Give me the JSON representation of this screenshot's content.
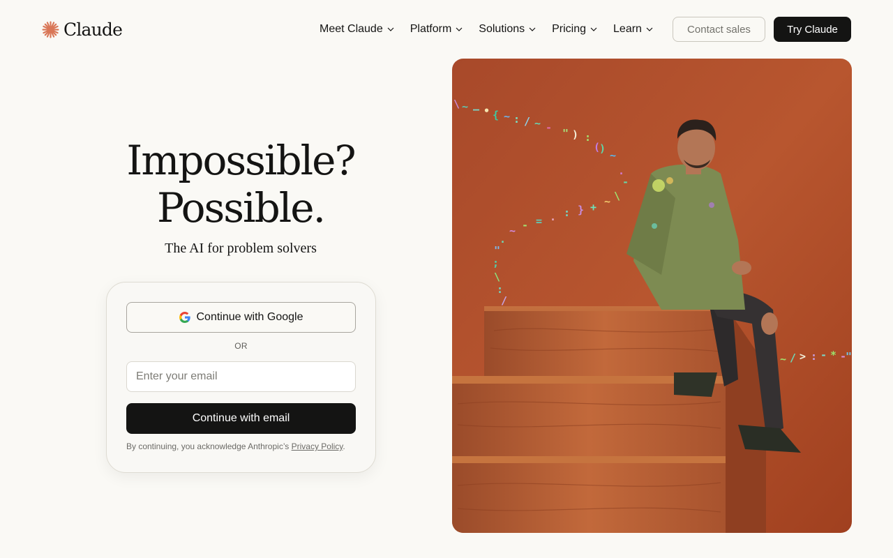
{
  "header": {
    "logo_text": "Claude",
    "logo_icon": "claude-starburst-icon",
    "nav": [
      {
        "label": "Meet Claude",
        "icon": "chevron-down-icon"
      },
      {
        "label": "Platform",
        "icon": "chevron-down-icon"
      },
      {
        "label": "Solutions",
        "icon": "chevron-down-icon"
      },
      {
        "label": "Pricing",
        "icon": "chevron-down-icon"
      },
      {
        "label": "Learn",
        "icon": "chevron-down-icon"
      }
    ],
    "contact_label": "Contact sales",
    "try_label": "Try Claude"
  },
  "hero": {
    "headline_line1": "Impossible?",
    "headline_line2": "Possible.",
    "subheadline": "The AI for problem solvers"
  },
  "login": {
    "google_label": "Continue with Google",
    "google_icon": "google-g-icon",
    "or_text": "OR",
    "email_value": "",
    "email_placeholder": "Enter your email",
    "email_button_label": "Continue with email",
    "legal_prefix": "By continuing, you acknowledge Anthropic’s",
    "legal_link": "Privacy Policy",
    "legal_suffix": "."
  },
  "colors": {
    "background": "#faf9f5",
    "primary_text": "#141413",
    "dark_button": "#141413",
    "brand_orange": "#d97757",
    "photo_backdrop": "#b5532d"
  }
}
